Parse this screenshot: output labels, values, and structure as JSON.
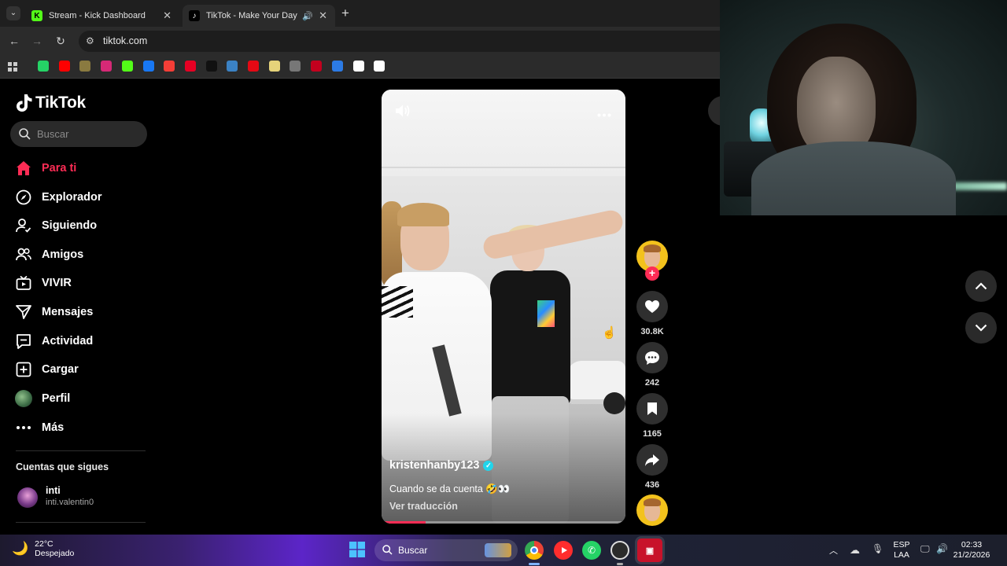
{
  "browser": {
    "tabs": [
      {
        "label": "Stream - Kick Dashboard",
        "active": false,
        "favicon_color": "#53fc18",
        "favicon_letter": "K"
      },
      {
        "label": "TikTok - Make Your Day",
        "active": true,
        "favicon_color": "#000000",
        "favicon_letter": "♪"
      }
    ],
    "new_tab_icon": "plus-icon",
    "url": "tiktok.com",
    "bookmarks": [
      {
        "name": "whatsapp",
        "color": "#25d366"
      },
      {
        "name": "youtube",
        "color": "#ff0000"
      },
      {
        "name": "app-round",
        "color": "#8a7a40"
      },
      {
        "name": "instagram",
        "color": "#d62976"
      },
      {
        "name": "kick",
        "color": "#53fc18"
      },
      {
        "name": "facebook",
        "color": "#1877f2"
      },
      {
        "name": "pocket-casts",
        "color": "#f43e37"
      },
      {
        "name": "pinterest",
        "color": "#e60023"
      },
      {
        "name": "tiktok",
        "color": "#111111"
      },
      {
        "name": "grid-app",
        "color": "#3b82c4"
      },
      {
        "name": "netflix",
        "color": "#e50914"
      },
      {
        "name": "app-oval",
        "color": "#e6d37a"
      },
      {
        "name": "doc-app",
        "color": "#777777"
      },
      {
        "name": "red-app",
        "color": "#c3001e"
      },
      {
        "name": "gif-app",
        "color": "#2c7be5"
      },
      {
        "name": "diamond-app",
        "color": "#ffffff"
      },
      {
        "name": "e-app",
        "color": "#ffffff"
      }
    ]
  },
  "tiktok": {
    "brand": "TikTok",
    "accent": "#fe2c55",
    "search_placeholder": "Buscar",
    "nav": [
      {
        "label": "Para ti",
        "icon": "home-icon",
        "active": true
      },
      {
        "label": "Explorador",
        "icon": "compass-icon",
        "active": false
      },
      {
        "label": "Siguiendo",
        "icon": "user-check-icon",
        "active": false
      },
      {
        "label": "Amigos",
        "icon": "friends-icon",
        "active": false
      },
      {
        "label": "VIVIR",
        "icon": "live-icon",
        "active": false
      },
      {
        "label": "Mensajes",
        "icon": "send-icon",
        "active": false
      },
      {
        "label": "Actividad",
        "icon": "activity-icon",
        "active": false
      },
      {
        "label": "Cargar",
        "icon": "upload-icon",
        "active": false
      },
      {
        "label": "Perfil",
        "icon": "profile-avatar-icon",
        "active": false
      },
      {
        "label": "Más",
        "icon": "more-icon",
        "active": false
      }
    ],
    "following_title": "Cuentas que sigues",
    "following": [
      {
        "name": "inti",
        "handle": "inti.valentin0"
      }
    ],
    "video": {
      "username": "kristenhanby123",
      "verified": true,
      "caption": "Cuando se da cuenta 🤣👀",
      "translate": "Ver traducción",
      "progress": 0.18
    },
    "actions": {
      "likes": "30.8K",
      "comments": "242",
      "saves": "1165",
      "shares": "436"
    }
  },
  "taskbar": {
    "temperature": "22°C",
    "weather": "Despejado",
    "search_placeholder": "Buscar",
    "language_line1": "ESP",
    "language_line2": "LAA",
    "time": "02:33",
    "date": "21/2/2026"
  }
}
